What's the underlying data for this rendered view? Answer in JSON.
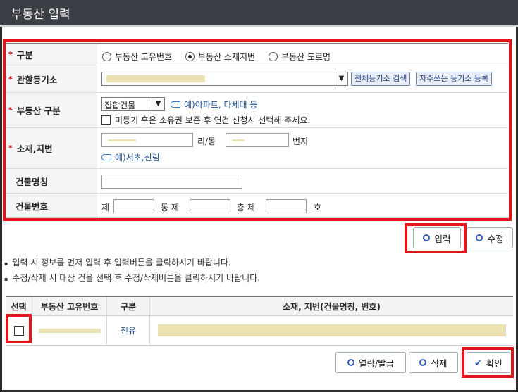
{
  "title": "부동산 입력",
  "form": {
    "type_label": "구분",
    "type_options": [
      "부동산 고유번호",
      "부동산 소재지번",
      "부동산 도로명"
    ],
    "type_selected": "부동산 소재지번",
    "registry_label": "관할등기소",
    "registry_search_label": "전체등기소 검색",
    "registry_favorite_label": "자주쓰는 등기소 등록",
    "category_label": "부동산 구분",
    "category_value": "집합건물",
    "category_hint": "예)아파트, 다세대 등",
    "unregistered_text": "미등기 혹은 소유권 보존 후 연건 신청시 선택해 주세요.",
    "address_label": "소재,지번",
    "ri_dong": "리/동",
    "bunji": "번지",
    "address_hint": "예)서초,신림",
    "building_name_label": "건물명칭",
    "building_no_label": "건물번호",
    "dong_prefix": "제",
    "dong_suffix": "동 제",
    "floor_suffix": "층 제",
    "ho_suffix": "호"
  },
  "actions": {
    "input": "입력",
    "edit": "수정"
  },
  "notes": [
    "입력 시 정보를 먼저 입력 후 입력버튼을 클릭하시기 바랍니다.",
    "수정/삭제 시 대상 건을 선택 후 수정/삭제버튼을 클릭하시기 바랍니다."
  ],
  "table": {
    "headers": [
      "선택",
      "부동산 고유번호",
      "구분",
      "소재, 지번(건물명칭, 번호)"
    ],
    "rows": [
      {
        "type": "전유"
      }
    ]
  },
  "bottom": {
    "view_issue": "열람/발급",
    "delete": "삭제",
    "confirm": "확인"
  }
}
